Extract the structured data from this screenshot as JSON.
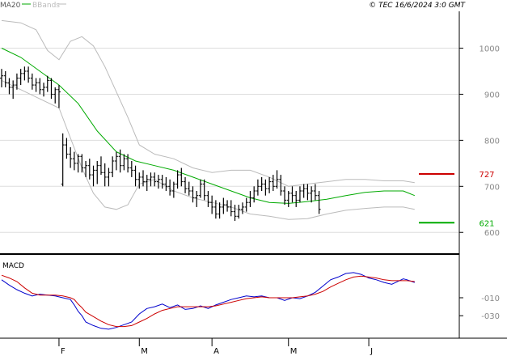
{
  "header": {
    "legend_ma": "MA20",
    "legend_bb": "BBands",
    "copyright": "© TEC 16/6/2024 3:0 GMT"
  },
  "colors": {
    "price": "#000000",
    "ma": "#00aa00",
    "bbands": "#bbbbbb",
    "resistance": "#cc0000",
    "support": "#00aa00",
    "macd": "#0000cc",
    "signal": "#cc0000",
    "grid": "#dddddd"
  },
  "chart_data": [
    {
      "type": "line",
      "name": "price-panel",
      "ylim": [
        560,
        1080
      ],
      "yticks": [
        {
          "value": 1000,
          "label": "1000"
        },
        {
          "value": 900,
          "label": "900"
        },
        {
          "value": 800,
          "label": "800"
        },
        {
          "value": 700,
          "label": "700"
        },
        {
          "value": 600,
          "label": "600"
        }
      ],
      "xticks": [
        {
          "index": 15,
          "label": "F"
        },
        {
          "index": 36,
          "label": "M"
        },
        {
          "index": 55,
          "label": "A"
        },
        {
          "index": 75,
          "label": "M"
        },
        {
          "index": 96,
          "label": "J"
        }
      ],
      "levels": [
        {
          "value": 727,
          "label": "727",
          "role": "resistance"
        },
        {
          "value": 621,
          "label": "621",
          "role": "support"
        }
      ],
      "ohlc": [
        [
          935,
          955,
          915,
          940
        ],
        [
          940,
          950,
          915,
          925
        ],
        [
          925,
          935,
          900,
          915
        ],
        [
          915,
          930,
          890,
          920
        ],
        [
          920,
          945,
          910,
          935
        ],
        [
          935,
          955,
          920,
          945
        ],
        [
          945,
          960,
          930,
          950
        ],
        [
          950,
          960,
          925,
          935
        ],
        [
          935,
          945,
          910,
          920
        ],
        [
          920,
          935,
          905,
          925
        ],
        [
          925,
          935,
          900,
          910
        ],
        [
          910,
          925,
          895,
          915
        ],
        [
          915,
          940,
          905,
          930
        ],
        [
          930,
          935,
          890,
          900
        ],
        [
          900,
          915,
          880,
          910
        ],
        [
          910,
          920,
          870,
          905
        ],
        [
          705,
          815,
          700,
          790
        ],
        [
          790,
          805,
          760,
          770
        ],
        [
          770,
          785,
          740,
          760
        ],
        [
          760,
          775,
          735,
          750
        ],
        [
          750,
          770,
          730,
          765
        ],
        [
          765,
          770,
          730,
          740
        ],
        [
          740,
          755,
          720,
          745
        ],
        [
          745,
          760,
          715,
          725
        ],
        [
          725,
          745,
          700,
          735
        ],
        [
          735,
          755,
          705,
          745
        ],
        [
          745,
          765,
          725,
          730
        ],
        [
          730,
          750,
          700,
          720
        ],
        [
          720,
          740,
          700,
          730
        ],
        [
          730,
          765,
          720,
          755
        ],
        [
          755,
          775,
          735,
          765
        ],
        [
          765,
          780,
          730,
          745
        ],
        [
          745,
          770,
          735,
          760
        ],
        [
          760,
          770,
          730,
          740
        ],
        [
          740,
          755,
          720,
          735
        ],
        [
          735,
          745,
          700,
          715
        ],
        [
          715,
          730,
          695,
          720
        ],
        [
          720,
          735,
          700,
          710
        ],
        [
          710,
          725,
          690,
          715
        ],
        [
          715,
          730,
          700,
          720
        ],
        [
          720,
          730,
          700,
          710
        ],
        [
          710,
          725,
          695,
          715
        ],
        [
          715,
          725,
          695,
          705
        ],
        [
          705,
          720,
          690,
          700
        ],
        [
          700,
          715,
          680,
          690
        ],
        [
          690,
          710,
          675,
          705
        ],
        [
          705,
          735,
          695,
          725
        ],
        [
          725,
          740,
          700,
          710
        ],
        [
          710,
          720,
          685,
          695
        ],
        [
          695,
          710,
          680,
          690
        ],
        [
          690,
          700,
          665,
          675
        ],
        [
          675,
          690,
          655,
          680
        ],
        [
          680,
          715,
          675,
          705
        ],
        [
          705,
          715,
          670,
          680
        ],
        [
          680,
          690,
          655,
          665
        ],
        [
          665,
          680,
          640,
          655
        ],
        [
          655,
          670,
          630,
          640
        ],
        [
          640,
          665,
          630,
          655
        ],
        [
          655,
          675,
          640,
          660
        ],
        [
          660,
          670,
          645,
          655
        ],
        [
          655,
          670,
          635,
          645
        ],
        [
          645,
          660,
          625,
          635
        ],
        [
          635,
          660,
          630,
          650
        ],
        [
          650,
          665,
          640,
          655
        ],
        [
          655,
          675,
          645,
          665
        ],
        [
          665,
          690,
          655,
          675
        ],
        [
          675,
          700,
          665,
          690
        ],
        [
          690,
          715,
          680,
          700
        ],
        [
          700,
          720,
          690,
          705
        ],
        [
          705,
          715,
          680,
          695
        ],
        [
          695,
          720,
          685,
          710
        ],
        [
          710,
          725,
          690,
          700
        ],
        [
          700,
          735,
          695,
          715
        ],
        [
          715,
          725,
          680,
          690
        ],
        [
          690,
          700,
          660,
          670
        ],
        [
          670,
          690,
          655,
          685
        ],
        [
          685,
          700,
          665,
          680
        ],
        [
          680,
          690,
          655,
          670
        ],
        [
          670,
          700,
          665,
          690
        ],
        [
          690,
          705,
          675,
          695
        ],
        [
          695,
          705,
          670,
          685
        ],
        [
          685,
          700,
          665,
          690
        ],
        [
          690,
          705,
          670,
          680
        ],
        [
          680,
          690,
          640,
          650
        ]
      ],
      "ma20": [
        [
          0,
          1000
        ],
        [
          5,
          980
        ],
        [
          10,
          950
        ],
        [
          15,
          920
        ],
        [
          20,
          880
        ],
        [
          25,
          820
        ],
        [
          30,
          775
        ],
        [
          35,
          755
        ],
        [
          40,
          745
        ],
        [
          45,
          735
        ],
        [
          50,
          720
        ],
        [
          55,
          705
        ],
        [
          60,
          690
        ],
        [
          65,
          675
        ],
        [
          70,
          665
        ],
        [
          75,
          663
        ],
        [
          80,
          667
        ],
        [
          85,
          672
        ],
        [
          90,
          680
        ],
        [
          95,
          687
        ],
        [
          100,
          690
        ],
        [
          105,
          690
        ],
        [
          108,
          680
        ]
      ],
      "bb_upper": [
        [
          0,
          1060
        ],
        [
          5,
          1055
        ],
        [
          9,
          1040
        ],
        [
          12,
          995
        ],
        [
          15,
          975
        ],
        [
          18,
          1015
        ],
        [
          21,
          1025
        ],
        [
          24,
          1005
        ],
        [
          27,
          960
        ],
        [
          30,
          905
        ],
        [
          33,
          850
        ],
        [
          36,
          790
        ],
        [
          40,
          770
        ],
        [
          45,
          760
        ],
        [
          50,
          740
        ],
        [
          55,
          730
        ],
        [
          60,
          735
        ],
        [
          65,
          735
        ],
        [
          70,
          720
        ],
        [
          75,
          700
        ],
        [
          80,
          705
        ],
        [
          85,
          710
        ],
        [
          90,
          715
        ],
        [
          95,
          715
        ],
        [
          100,
          712
        ],
        [
          105,
          712
        ],
        [
          108,
          708
        ]
      ],
      "bb_lower": [
        [
          0,
          930
        ],
        [
          5,
          910
        ],
        [
          10,
          890
        ],
        [
          15,
          870
        ],
        [
          18,
          805
        ],
        [
          21,
          740
        ],
        [
          24,
          685
        ],
        [
          27,
          655
        ],
        [
          30,
          650
        ],
        [
          33,
          660
        ],
        [
          36,
          705
        ],
        [
          40,
          715
        ],
        [
          45,
          690
        ],
        [
          50,
          675
        ],
        [
          55,
          665
        ],
        [
          60,
          655
        ],
        [
          65,
          640
        ],
        [
          70,
          635
        ],
        [
          75,
          628
        ],
        [
          80,
          630
        ],
        [
          85,
          640
        ],
        [
          90,
          648
        ],
        [
          95,
          652
        ],
        [
          100,
          655
        ],
        [
          105,
          655
        ],
        [
          108,
          650
        ]
      ]
    },
    {
      "type": "line",
      "name": "macd-panel",
      "title": "MACD",
      "ylim": [
        -55,
        35
      ],
      "yticks": [
        {
          "value": -10,
          "label": "-010"
        },
        {
          "value": -30,
          "label": "-030"
        }
      ],
      "series": [
        {
          "role": "macd",
          "points": [
            [
              0,
              10
            ],
            [
              2,
              4
            ],
            [
              4,
              -1
            ],
            [
              6,
              -5
            ],
            [
              8,
              -8
            ],
            [
              10,
              -6
            ],
            [
              12,
              -7
            ],
            [
              14,
              -8
            ],
            [
              16,
              -10
            ],
            [
              18,
              -12
            ],
            [
              19,
              -18
            ],
            [
              20,
              -25
            ],
            [
              21,
              -30
            ],
            [
              22,
              -37
            ],
            [
              24,
              -41
            ],
            [
              26,
              -44
            ],
            [
              28,
              -45
            ],
            [
              30,
              -43
            ],
            [
              32,
              -40
            ],
            [
              34,
              -37
            ],
            [
              36,
              -28
            ],
            [
              38,
              -22
            ],
            [
              40,
              -20
            ],
            [
              42,
              -17
            ],
            [
              44,
              -21
            ],
            [
              46,
              -18
            ],
            [
              48,
              -23
            ],
            [
              50,
              -22
            ],
            [
              52,
              -19
            ],
            [
              54,
              -22
            ],
            [
              56,
              -18
            ],
            [
              58,
              -15
            ],
            [
              60,
              -12
            ],
            [
              62,
              -10
            ],
            [
              64,
              -8
            ],
            [
              66,
              -9
            ],
            [
              68,
              -8
            ],
            [
              70,
              -10
            ],
            [
              72,
              -10
            ],
            [
              74,
              -13
            ],
            [
              76,
              -10
            ],
            [
              78,
              -11
            ],
            [
              80,
              -8
            ],
            [
              82,
              -4
            ],
            [
              84,
              3
            ],
            [
              86,
              10
            ],
            [
              88,
              13
            ],
            [
              90,
              17
            ],
            [
              92,
              18
            ],
            [
              94,
              16
            ],
            [
              96,
              12
            ],
            [
              98,
              10
            ],
            [
              100,
              7
            ],
            [
              102,
              5
            ],
            [
              104,
              9
            ],
            [
              105,
              11
            ],
            [
              106,
              10
            ],
            [
              108,
              7
            ]
          ]
        },
        {
          "role": "signal",
          "points": [
            [
              0,
              15
            ],
            [
              2,
              12
            ],
            [
              4,
              8
            ],
            [
              6,
              1
            ],
            [
              8,
              -5
            ],
            [
              10,
              -7
            ],
            [
              12,
              -7
            ],
            [
              14,
              -7
            ],
            [
              16,
              -8
            ],
            [
              18,
              -10
            ],
            [
              19,
              -12
            ],
            [
              20,
              -17
            ],
            [
              21,
              -21
            ],
            [
              22,
              -26
            ],
            [
              24,
              -31
            ],
            [
              26,
              -36
            ],
            [
              28,
              -40
            ],
            [
              30,
              -42
            ],
            [
              32,
              -42
            ],
            [
              34,
              -41
            ],
            [
              36,
              -37
            ],
            [
              38,
              -33
            ],
            [
              40,
              -28
            ],
            [
              42,
              -24
            ],
            [
              44,
              -22
            ],
            [
              46,
              -20
            ],
            [
              48,
              -20
            ],
            [
              50,
              -20
            ],
            [
              52,
              -20
            ],
            [
              54,
              -20
            ],
            [
              56,
              -19
            ],
            [
              58,
              -17
            ],
            [
              60,
              -15
            ],
            [
              62,
              -13
            ],
            [
              64,
              -11
            ],
            [
              66,
              -10
            ],
            [
              68,
              -9
            ],
            [
              70,
              -10
            ],
            [
              72,
              -10
            ],
            [
              74,
              -10
            ],
            [
              76,
              -10
            ],
            [
              78,
              -9
            ],
            [
              80,
              -8
            ],
            [
              82,
              -6
            ],
            [
              84,
              -3
            ],
            [
              86,
              2
            ],
            [
              88,
              6
            ],
            [
              90,
              10
            ],
            [
              92,
              13
            ],
            [
              94,
              14
            ],
            [
              96,
              13
            ],
            [
              98,
              12
            ],
            [
              100,
              10
            ],
            [
              102,
              9
            ],
            [
              104,
              9
            ],
            [
              105,
              9
            ],
            [
              106,
              9
            ],
            [
              108,
              8
            ]
          ]
        }
      ]
    }
  ]
}
